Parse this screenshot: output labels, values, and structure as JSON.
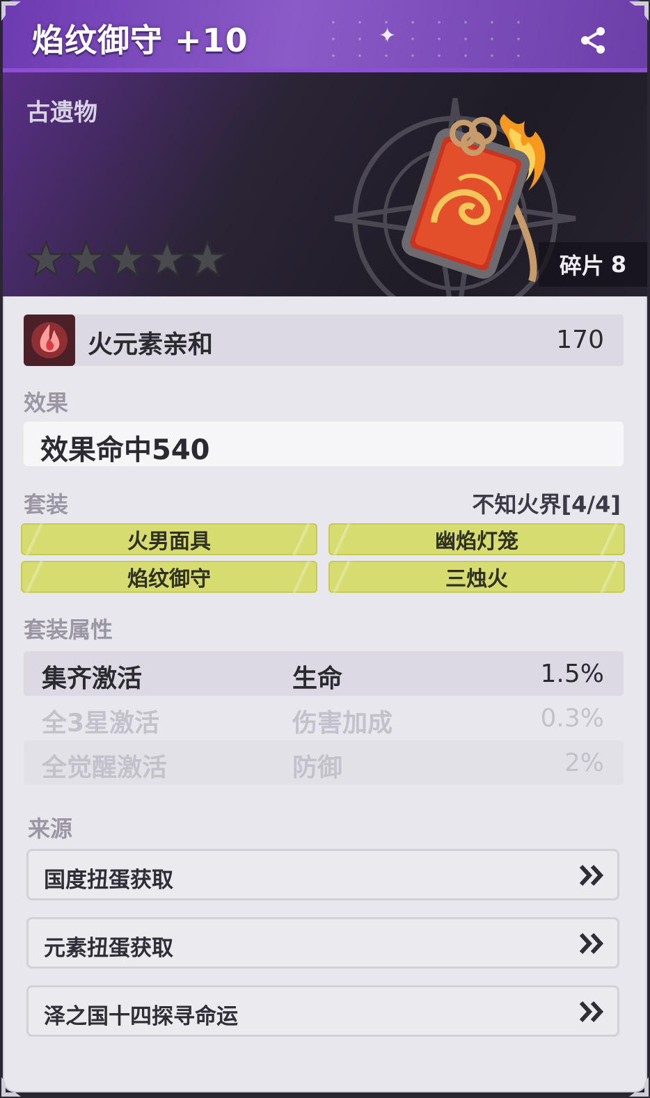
{
  "header": {
    "title": "焰纹御守 +10"
  },
  "hero": {
    "category": "古遗物",
    "star_count": 5,
    "shards_label": "碎片",
    "shards_value": "8"
  },
  "affinity": {
    "name": "火元素亲和",
    "value": "170"
  },
  "effect": {
    "label": "效果",
    "text": "效果命中540"
  },
  "set": {
    "label": "套装",
    "name": "不知火界[4/4]",
    "pieces": [
      "火男面具",
      "幽焰灯笼",
      "焰纹御守",
      "三烛火"
    ]
  },
  "set_attrs": {
    "label": "套装属性",
    "rows": [
      {
        "condition": "集齐激活",
        "stat": "生命",
        "value": "1.5%"
      },
      {
        "condition": "全3星激活",
        "stat": "伤害加成",
        "value": "0.3%"
      },
      {
        "condition": "全觉醒激活",
        "stat": "防御",
        "value": "2%"
      }
    ]
  },
  "source": {
    "label": "来源",
    "items": [
      "国度扭蛋获取",
      "元素扭蛋获取",
      "泽之国十四探寻命运"
    ]
  },
  "colors": {
    "header_purple": "#7a45bb",
    "set_button": "#d6dc6f",
    "panel_bg": "#e9e7ee"
  },
  "icons": [
    "share-icon",
    "star-icon",
    "fire-element-icon",
    "double-chevron-right-icon"
  ]
}
